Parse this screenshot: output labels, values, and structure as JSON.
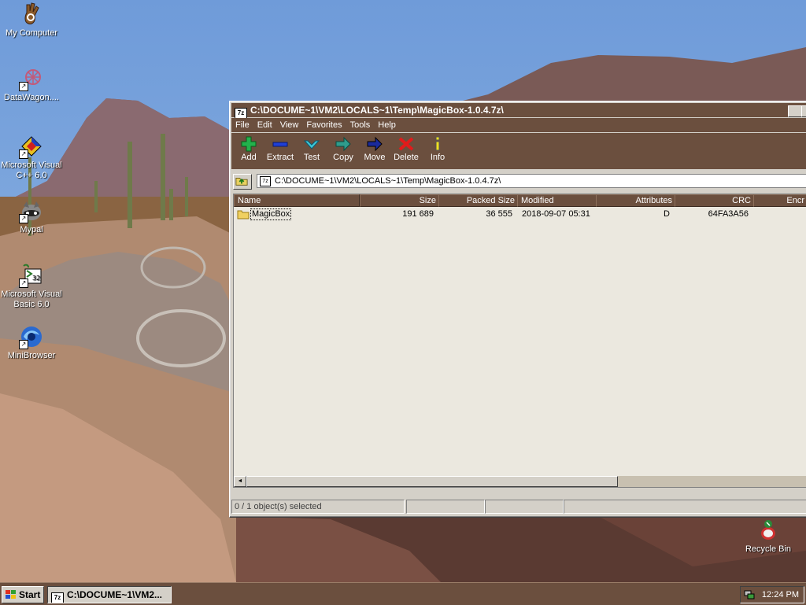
{
  "desktop": {
    "icons": [
      {
        "label": "My Computer",
        "icon": "my-computer-icon"
      },
      {
        "label": "DataWagon....",
        "icon": "datawagon-icon"
      },
      {
        "label": "Microsoft Visual C++ 6.0",
        "icon": "visual-cpp-icon"
      },
      {
        "label": "Mypal",
        "icon": "mypal-icon"
      },
      {
        "label": "Microsoft Visual Basic 6.0",
        "icon": "visual-basic-icon"
      },
      {
        "label": "MiniBrowser",
        "icon": "minibrowser-icon"
      },
      {
        "label": "Recycle Bin",
        "icon": "recycle-bin-icon"
      }
    ]
  },
  "window": {
    "title": "C:\\DOCUME~1\\VM2\\LOCALS~1\\Temp\\MagicBox-1.0.4.7z\\",
    "title_icon": "7z",
    "menu": [
      "File",
      "Edit",
      "View",
      "Favorites",
      "Tools",
      "Help"
    ],
    "toolbar": [
      {
        "label": "Add",
        "icon": "plus-icon",
        "color": "#22b14c"
      },
      {
        "label": "Extract",
        "icon": "minus-icon",
        "color": "#1f3fd6"
      },
      {
        "label": "Test",
        "icon": "check-icon",
        "color": "#3fc6d6"
      },
      {
        "label": "Copy",
        "icon": "copy-arrow-icon",
        "color": "#2f9c8c"
      },
      {
        "label": "Move",
        "icon": "move-arrow-icon",
        "color": "#1a2a9c"
      },
      {
        "label": "Delete",
        "icon": "delete-x-icon",
        "color": "#e11b1b"
      },
      {
        "label": "Info",
        "icon": "info-icon",
        "color": "#f0e020"
      }
    ],
    "address": "C:\\DOCUME~1\\VM2\\LOCALS~1\\Temp\\MagicBox-1.0.4.7z\\",
    "columns": [
      "Name",
      "Size",
      "Packed Size",
      "Modified",
      "Attributes",
      "CRC",
      "Encr"
    ],
    "rows": [
      {
        "name": "MagicBox",
        "size": "191 689",
        "packed": "36 555",
        "modified": "2018-09-07 05:31",
        "attributes": "D",
        "crc": "64FA3A56",
        "encrypted": ""
      }
    ],
    "status": "0 / 1 object(s) selected"
  },
  "taskbar": {
    "start_label": "Start",
    "task_label": "C:\\DOCUME~1\\VM2...",
    "task_icon": "7z",
    "clock": "12:24 PM"
  },
  "colors": {
    "theme_brown": "#6b4f3e",
    "sky": "#86aee0"
  }
}
